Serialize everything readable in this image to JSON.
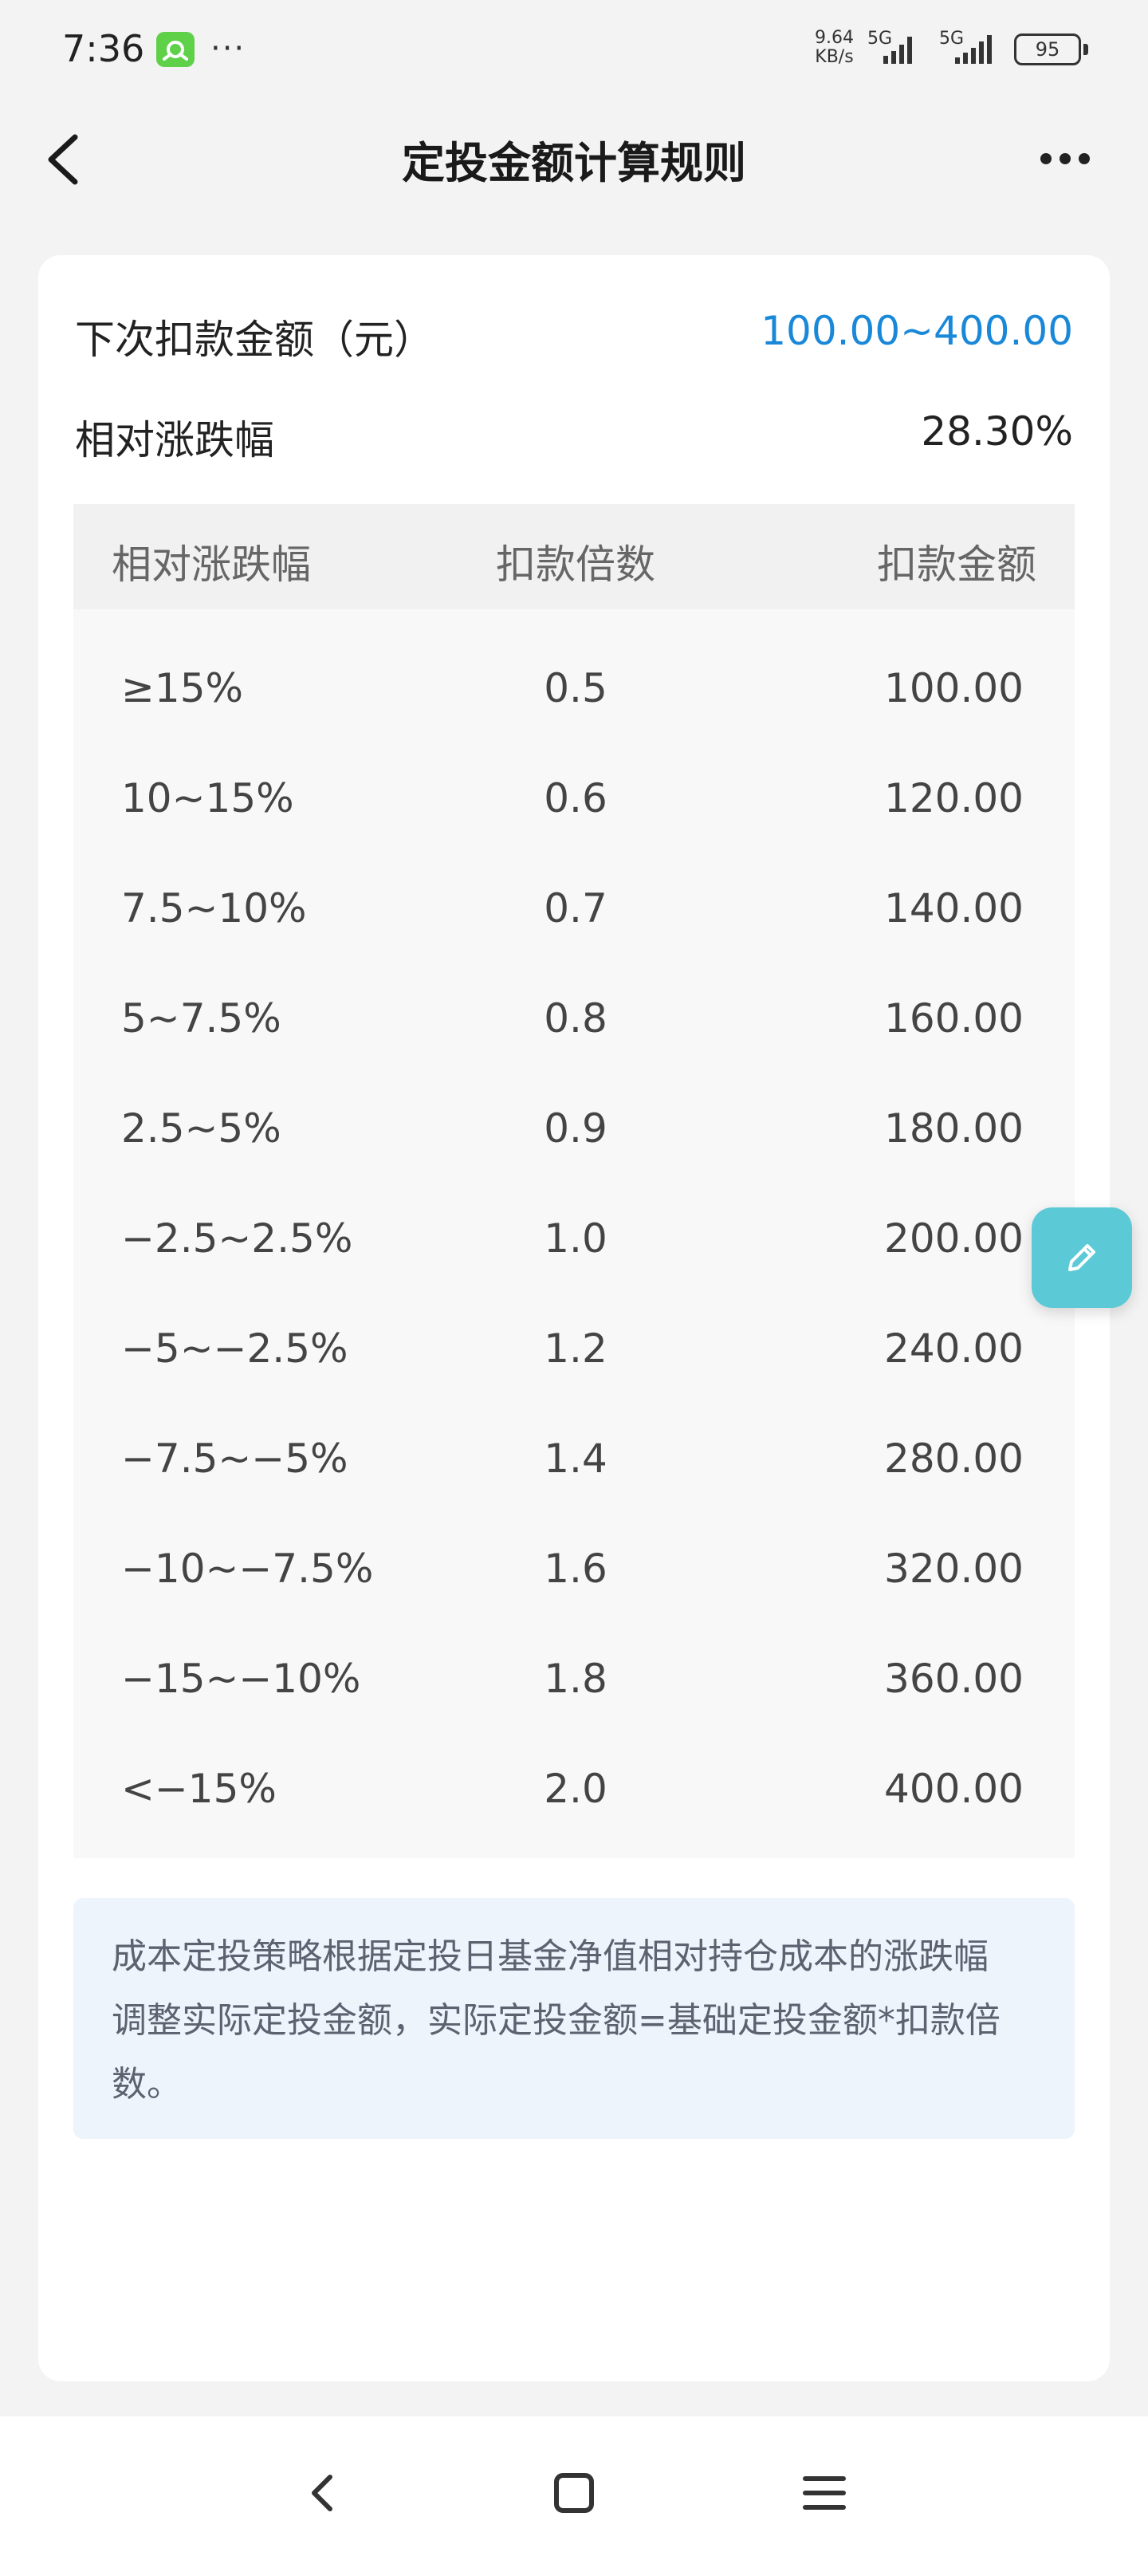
{
  "status_bar": {
    "time": "7:36",
    "more": "···",
    "net_speed": "9.64",
    "net_unit": "KB/s",
    "signal1": "5G",
    "signal2": "5G",
    "battery": "95"
  },
  "header": {
    "title": "定投金额计算规则"
  },
  "summary": {
    "next_label": "下次扣款金额（元）",
    "next_value": "100.00~400.00",
    "change_label": "相对涨跌幅",
    "change_value": "28.30%"
  },
  "table": {
    "headers": [
      "相对涨跌幅",
      "扣款倍数",
      "扣款金额"
    ],
    "rows": [
      [
        "≥15%",
        "0.5",
        "100.00"
      ],
      [
        "10~15%",
        "0.6",
        "120.00"
      ],
      [
        "7.5~10%",
        "0.7",
        "140.00"
      ],
      [
        "5~7.5%",
        "0.8",
        "160.00"
      ],
      [
        "2.5~5%",
        "0.9",
        "180.00"
      ],
      [
        "−2.5~2.5%",
        "1.0",
        "200.00"
      ],
      [
        "−5~−2.5%",
        "1.2",
        "240.00"
      ],
      [
        "−7.5~−5%",
        "1.4",
        "280.00"
      ],
      [
        "−10~−7.5%",
        "1.6",
        "320.00"
      ],
      [
        "−15~−10%",
        "1.8",
        "360.00"
      ],
      [
        "<−15%",
        "2.0",
        "400.00"
      ]
    ]
  },
  "note": {
    "line1": "成本定投策略根据定投日基金净值相对持仓成本的涨跌幅",
    "line2": "调整实际定投金额，实际定投金额=基础定投金额*扣款倍",
    "line3": "数。"
  },
  "colors": {
    "accent_blue": "#1a88d8",
    "float_button": "#5cc9d6",
    "note_bg": "#eef4fc"
  },
  "icons": {
    "back": "chevron-left-icon",
    "more": "more-dots-icon",
    "float": "pencil-icon",
    "nav_back": "nav-back-icon",
    "nav_home": "nav-home-icon",
    "nav_menu": "nav-menu-icon"
  }
}
